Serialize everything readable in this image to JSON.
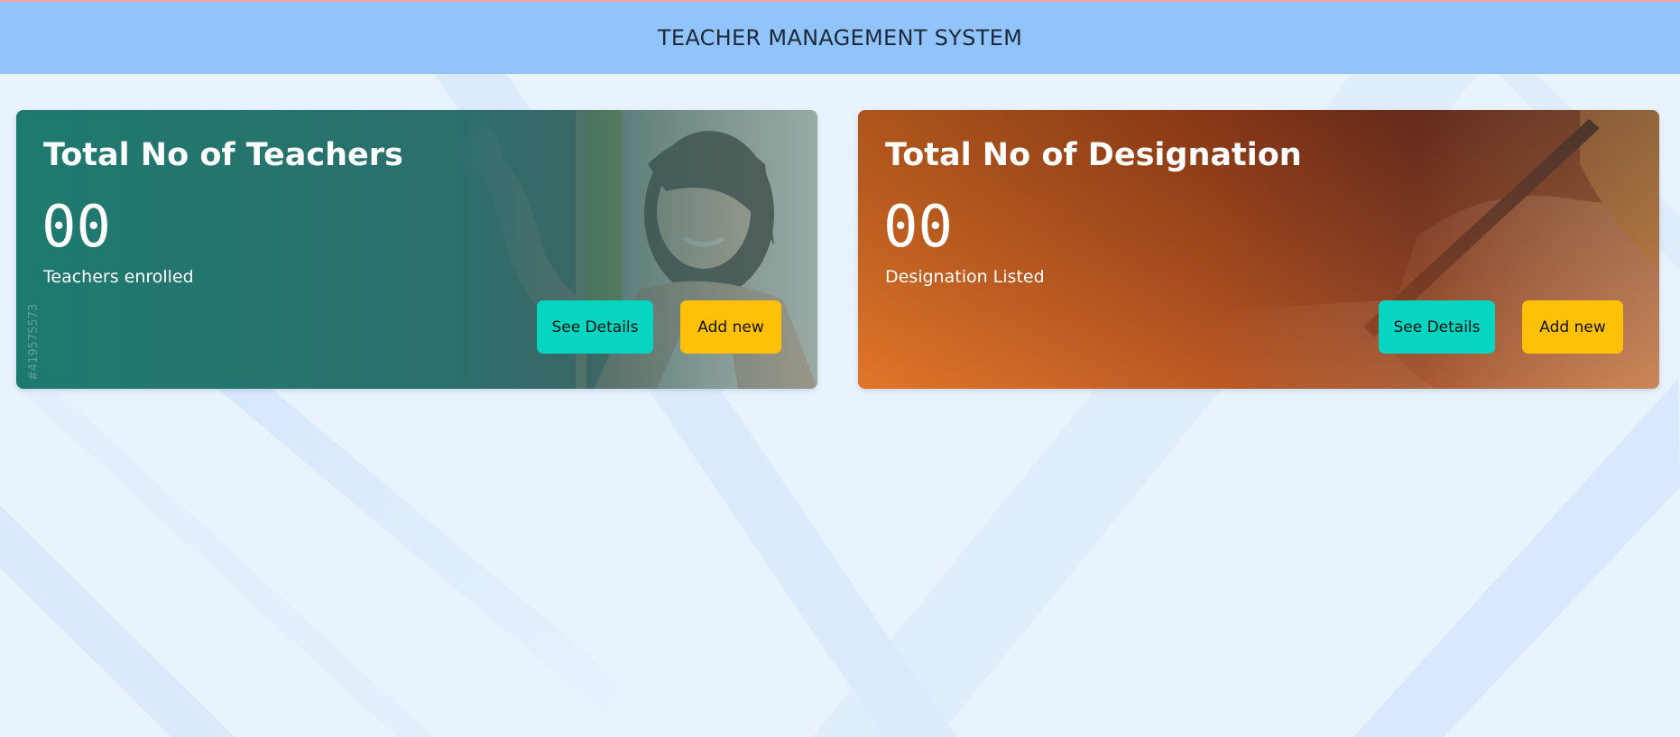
{
  "header": {
    "title": "TEACHER MANAGEMENT SYSTEM"
  },
  "cards": [
    {
      "title": "Total No of Teachers",
      "count": "00",
      "caption": "Teachers enrolled",
      "details_label": "See Details",
      "add_label": "Add new",
      "watermark": "#419575573"
    },
    {
      "title": "Total No of Designation",
      "count": "00",
      "caption": "Designation Listed",
      "details_label": "See Details",
      "add_label": "Add new"
    }
  ],
  "colors": {
    "header_bg": "#90c4fb",
    "page_bg": "#e8f2fd",
    "teachers_card": "#1f7a73",
    "designation_card": "#c8621f",
    "details_button": "#06d6c1",
    "add_button": "#ffc107"
  }
}
